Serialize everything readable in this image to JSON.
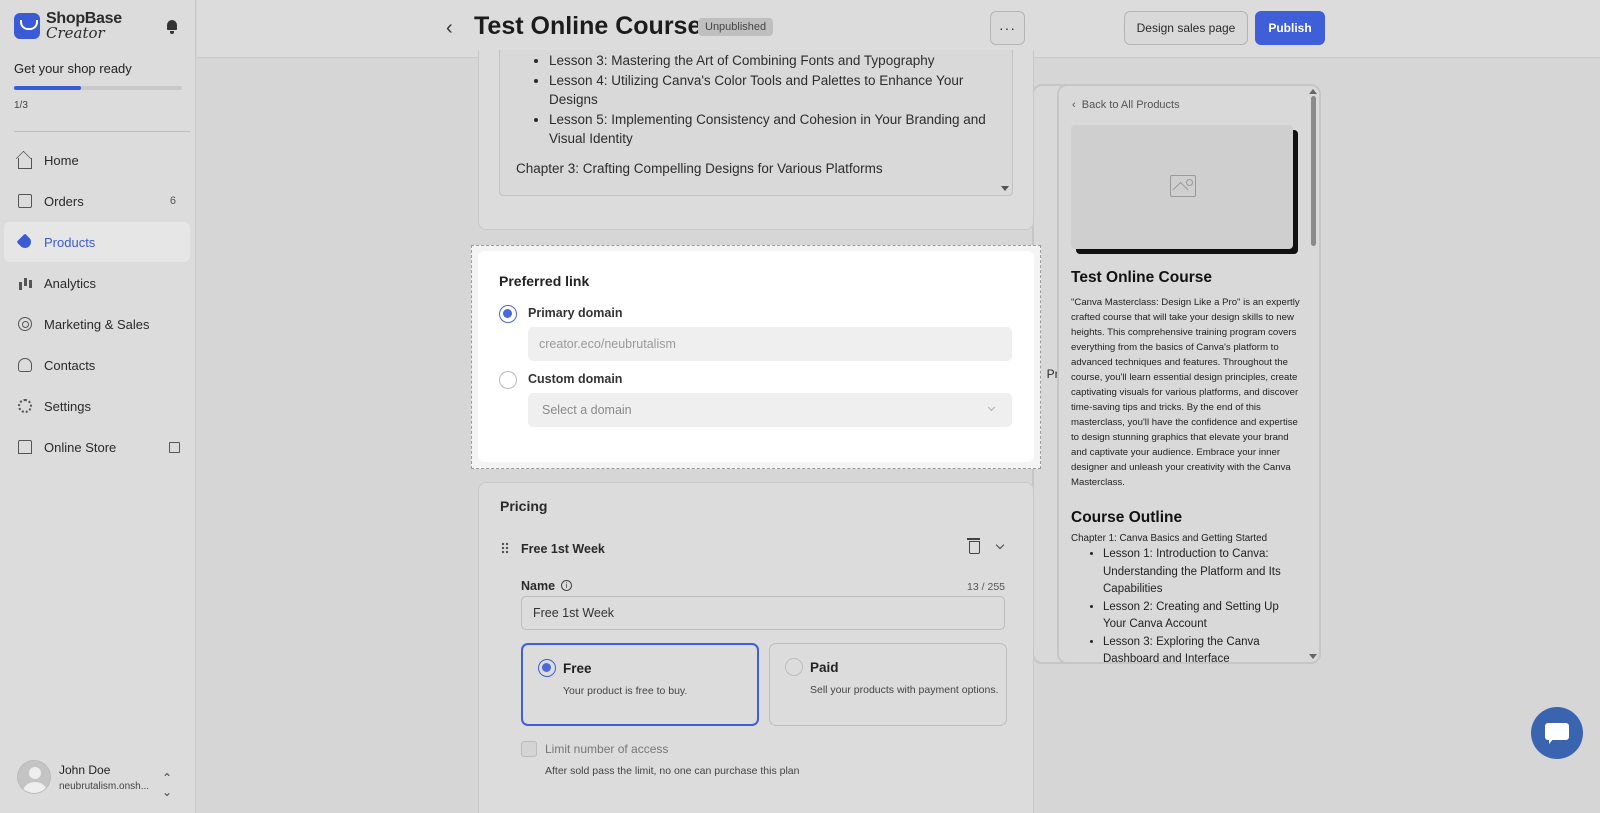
{
  "app": {
    "brand_line1": "ShopBase",
    "brand_line2": "Creator"
  },
  "sidebar": {
    "setup_title": "Get your shop ready",
    "setup_progress": "1/3",
    "setup_progress_fraction": 0.333,
    "items": [
      {
        "label": "Home",
        "icon": "home-icon"
      },
      {
        "label": "Orders",
        "icon": "orders-icon",
        "count": "6"
      },
      {
        "label": "Products",
        "icon": "tag-icon",
        "active": true
      },
      {
        "label": "Analytics",
        "icon": "chart-icon"
      },
      {
        "label": "Marketing & Sales",
        "icon": "target-icon"
      },
      {
        "label": "Contacts",
        "icon": "contacts-icon"
      },
      {
        "label": "Settings",
        "icon": "gear-icon"
      },
      {
        "label": "Online Store",
        "icon": "store-icon"
      }
    ],
    "user": {
      "name": "John Doe",
      "store": "neubrutalism.onsh..."
    }
  },
  "header": {
    "title": "Test Online Course",
    "status": "Unpublished",
    "more": "···",
    "preview": "Preview",
    "design": "Design sales page",
    "publish": "Publish"
  },
  "description": {
    "lessons": [
      "Lesson 3: Mastering the Art of Combining Fonts and Typography",
      "Lesson 4: Utilizing Canva's Color Tools and Palettes to Enhance Your Designs",
      "Lesson 5: Implementing Consistency and Cohesion in Your Branding and Visual Identity"
    ],
    "chapter": "Chapter 3: Crafting Compelling Designs for Various Platforms"
  },
  "preferred_link": {
    "title": "Preferred link",
    "primary_label": "Primary domain",
    "primary_value": "creator.eco/neubrutalism",
    "custom_label": "Custom domain",
    "custom_placeholder": "Select a domain"
  },
  "pricing": {
    "title": "Pricing",
    "plan_name": "Free 1st Week",
    "name_label": "Name",
    "char_count": "13 / 255",
    "name_value": "Free 1st Week",
    "free_title": "Free",
    "free_desc": "Your product is free to buy.",
    "paid_title": "Paid",
    "paid_desc": "Sell your products with payment options.",
    "limit_label": "Limit number of access",
    "limit_help": "After sold pass the limit, no one can purchase this plan"
  },
  "preview": {
    "back": "Back to All Products",
    "title": "Test Online Course",
    "description": "\"Canva Masterclass: Design Like a Pro\" is an expertly crafted course that will take your design skills to new heights. This comprehensive training program covers everything from the basics of Canva's platform to advanced techniques and features. Throughout the course, you'll learn essential design principles, create captivating visuals for various platforms, and discover time-saving tips and tricks. By the end of this masterclass, you'll have the confidence and expertise to design stunning graphics that elevate your brand and captivate your audience. Embrace your inner designer and unleash your creativity with the Canva Masterclass.",
    "outline_title": "Course Outline",
    "chapter": "Chapter 1: Canva Basics and Getting Started",
    "lessons": [
      "Lesson 1: Introduction to Canva: Understanding the Platform and Its Capabilities",
      "Lesson 2: Creating and Setting Up Your Canva Account",
      "Lesson 3: Exploring the Canva Dashboard and Interface"
    ]
  },
  "colors": {
    "accent": "#3f5fd8",
    "chat": "#3a63b0"
  }
}
